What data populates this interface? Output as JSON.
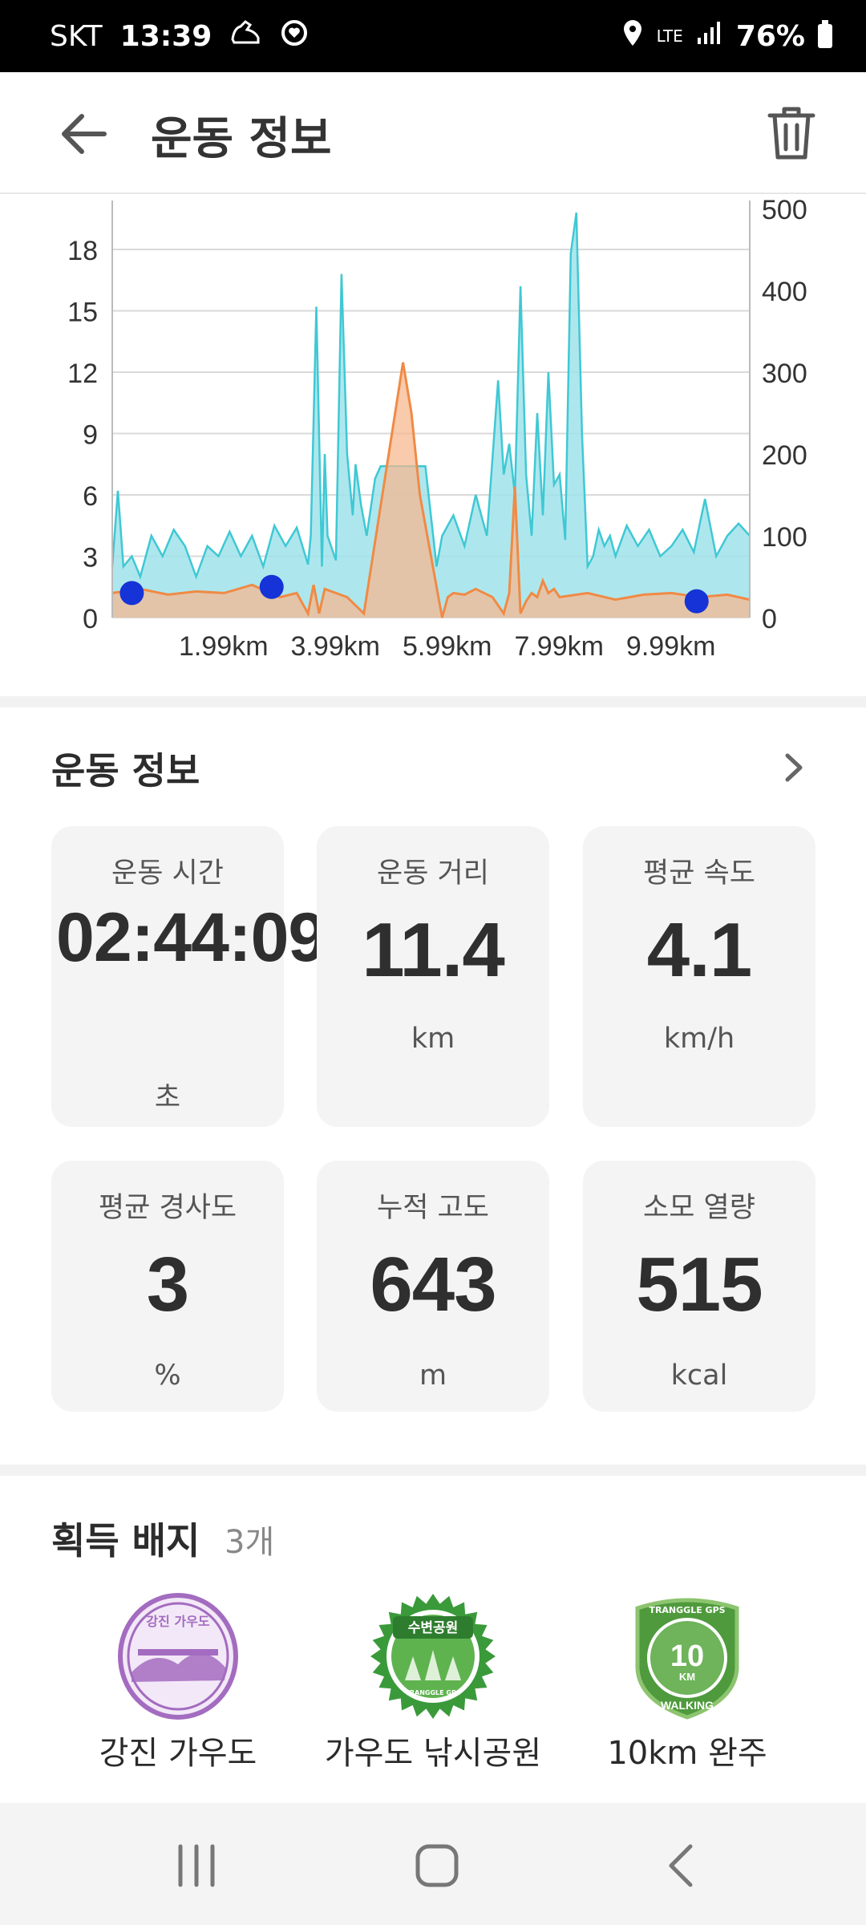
{
  "status_bar": {
    "carrier": "SKT",
    "time": "13:39",
    "network": "LTE",
    "battery": "76%"
  },
  "header": {
    "title": "운동 정보"
  },
  "chart_data": {
    "type": "area",
    "x_tick_labels": [
      "1.99km",
      "3.99km",
      "5.99km",
      "7.99km",
      "9.99km"
    ],
    "y_left_ticks": [
      0,
      3,
      6,
      9,
      12,
      15,
      18
    ],
    "y_right_ticks": [
      0,
      100,
      200,
      300,
      400,
      500
    ],
    "y_left_range": [
      0,
      20
    ],
    "y_right_range": [
      0,
      500
    ],
    "x_range_km": [
      0,
      11.4
    ],
    "grid": true,
    "series": [
      {
        "color": "#47cdd8",
        "axis": "left",
        "x": [
          0,
          0.1,
          0.2,
          0.35,
          0.5,
          0.7,
          0.9,
          1.1,
          1.3,
          1.5,
          1.7,
          1.9,
          2.1,
          2.3,
          2.5,
          2.7,
          2.9,
          3.1,
          3.3,
          3.5,
          3.55,
          3.65,
          3.75,
          3.8,
          3.85,
          4.0,
          4.1,
          4.2,
          4.3,
          4.35,
          4.45,
          4.55,
          4.7,
          4.8,
          5.0,
          5.2,
          5.4,
          5.6,
          5.8,
          5.9,
          6.1,
          6.3,
          6.5,
          6.7,
          6.9,
          7.0,
          7.1,
          7.2,
          7.3,
          7.4,
          7.5,
          7.6,
          7.7,
          7.8,
          7.9,
          8.0,
          8.1,
          8.2,
          8.3,
          8.4,
          8.5,
          8.6,
          8.7,
          8.8,
          8.9,
          9.0,
          9.2,
          9.4,
          9.6,
          9.8,
          10.0,
          10.2,
          10.4,
          10.6,
          10.8,
          11.0,
          11.2,
          11.4
        ],
        "y": [
          2.5,
          6.2,
          2.5,
          3.0,
          2.0,
          4.0,
          3.0,
          4.3,
          3.5,
          2.0,
          3.5,
          3.0,
          4.2,
          3.0,
          4.0,
          2.5,
          4.5,
          3.5,
          4.4,
          2.6,
          4.0,
          15.2,
          2.5,
          8.0,
          4.0,
          2.8,
          16.8,
          8.0,
          5.0,
          7.5,
          5.5,
          4.0,
          6.8,
          7.4,
          7.4,
          7.4,
          7.4,
          7.4,
          2.5,
          4.0,
          5.0,
          3.5,
          6.0,
          4.0,
          11.6,
          7.0,
          8.5,
          6.0,
          16.2,
          7.0,
          4.0,
          10.0,
          5.0,
          12.0,
          6.5,
          7.0,
          3.8,
          17.8,
          19.8,
          9.0,
          2.5,
          3.0,
          4.3,
          3.5,
          4.0,
          3.0,
          4.5,
          3.5,
          4.3,
          3.0,
          3.5,
          4.3,
          3.2,
          5.8,
          3.0,
          4.0,
          4.6,
          4.0
        ]
      },
      {
        "color": "#f08a45",
        "axis": "right",
        "x": [
          0,
          0.5,
          1.0,
          1.5,
          2.0,
          2.5,
          3.0,
          3.3,
          3.5,
          3.6,
          3.7,
          3.8,
          4.0,
          4.2,
          4.5,
          5.2,
          5.35,
          5.5,
          5.9,
          6.0,
          6.1,
          6.3,
          6.5,
          6.8,
          7.0,
          7.1,
          7.2,
          7.3,
          7.4,
          7.5,
          7.6,
          7.7,
          7.8,
          7.9,
          8.0,
          8.5,
          9.0,
          9.5,
          10.0,
          10.5,
          11.0,
          11.4
        ],
        "y": [
          30,
          35,
          28,
          32,
          30,
          40,
          25,
          30,
          5,
          40,
          5,
          35,
          30,
          25,
          5,
          312,
          250,
          150,
          0,
          25,
          30,
          28,
          35,
          25,
          5,
          30,
          160,
          5,
          20,
          30,
          25,
          45,
          30,
          35,
          25,
          30,
          22,
          28,
          30,
          25,
          28,
          22
        ]
      }
    ],
    "markers": [
      {
        "x": 0.35,
        "y_left": 1.2
      },
      {
        "x": 2.85,
        "y_left": 1.5
      },
      {
        "x": 10.45,
        "y_left": 0.8
      }
    ]
  },
  "info": {
    "title": "운동 정보",
    "cards": [
      {
        "label": "운동 시간",
        "value": "02:44:09",
        "unit": "초"
      },
      {
        "label": "운동 거리",
        "value": "11.4",
        "unit": "km"
      },
      {
        "label": "평균 속도",
        "value": "4.1",
        "unit": "km/h"
      },
      {
        "label": "평균 경사도",
        "value": "3",
        "unit": "%"
      },
      {
        "label": "누적 고도",
        "value": "643",
        "unit": "m"
      },
      {
        "label": "소모 열량",
        "value": "515",
        "unit": "kcal"
      }
    ]
  },
  "badges": {
    "title": "획득 배지",
    "count": "3개",
    "items": [
      {
        "name": "강진 가우도",
        "badge_text": "강진 가우도",
        "color": "#a36cc0"
      },
      {
        "name": "가우도 낚시공원",
        "badge_text": "수변공원",
        "sub_text": "TRANGGLE GPS",
        "color": "#3a9a3a"
      },
      {
        "name": "10km 완주",
        "badge_text": "10",
        "sub_text": "KM",
        "ring_text": "WALKING",
        "top_text": "TRANGGLE GPS",
        "color": "#4e9a3c"
      }
    ]
  },
  "colors": {
    "speed_fill": "#9fe3ea",
    "speed_line": "#3fc8d4",
    "elevation_fill": "#f7b890",
    "elevation_line": "#f08a45",
    "marker": "#1533d6"
  }
}
